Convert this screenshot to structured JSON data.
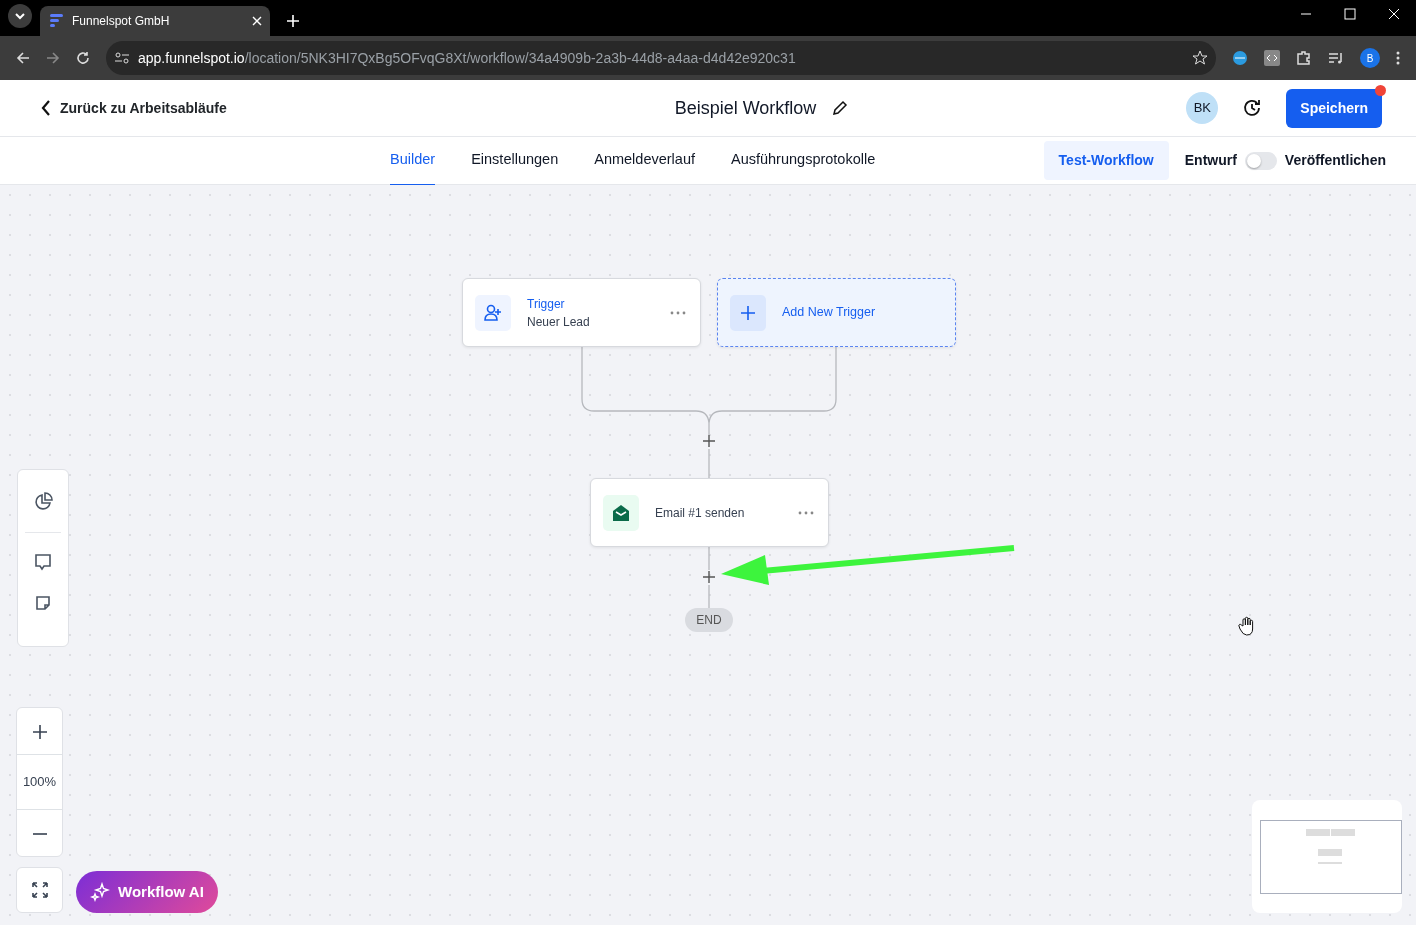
{
  "browser": {
    "tab_title": "Funnelspot GmbH",
    "url_host": "app.funnelspot.io",
    "url_path": "/location/5NK3HI7QxBg5OFvqG8Xt/workflow/34a4909b-2a3b-44d8-a4aa-d4d42e920c31",
    "profile_initial": "B"
  },
  "header": {
    "back_label": "Zurück zu Arbeitsabläufe",
    "title": "Beispiel Workflow",
    "avatar": "BK",
    "save_label": "Speichern",
    "save_notification": true
  },
  "tabs": [
    {
      "label": "Builder",
      "selected": true
    },
    {
      "label": "Einstellungen",
      "selected": false
    },
    {
      "label": "Anmeldeverlauf",
      "selected": false
    },
    {
      "label": "Ausführungsprotokolle",
      "selected": false
    }
  ],
  "test_label": "Test-Workflow",
  "publish_toggle": {
    "off_label": "Entwurf",
    "on_label": "Veröffentlichen",
    "on": false
  },
  "triggers": [
    {
      "kind": "trigger",
      "title": "Trigger",
      "subtitle": "Neuer Lead"
    },
    {
      "kind": "add",
      "title": "Add New Trigger"
    }
  ],
  "actions": [
    {
      "kind": "email",
      "title": "Email #1 senden"
    }
  ],
  "end_label": "END",
  "zoom_level": "100%",
  "ai_label": "Workflow AI"
}
